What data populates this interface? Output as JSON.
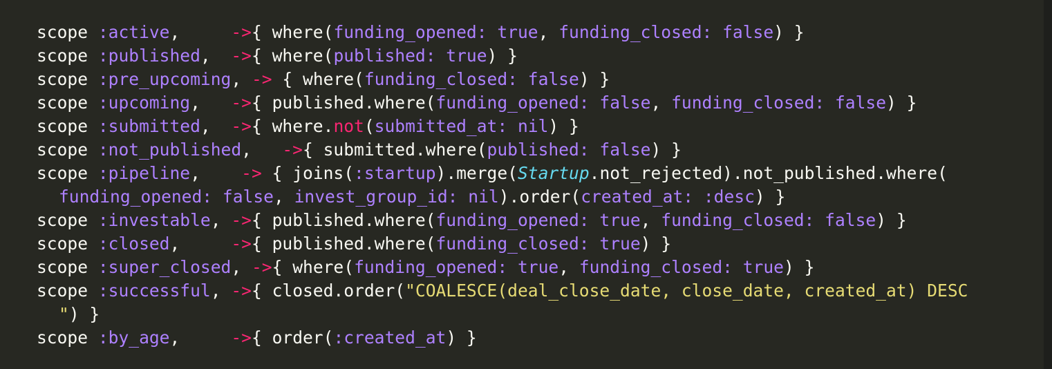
{
  "colors": {
    "background": "#272822",
    "plain": "#F8F8F2",
    "symbol": "#AE81FF",
    "operator": "#F92672",
    "constant": "#66D9EF",
    "string": "#E6DB74"
  },
  "code": {
    "lines": [
      [
        {
          "t": "kw",
          "s": "scope "
        },
        {
          "t": "sym",
          "s": ":active"
        },
        {
          "t": "pl",
          "s": ",     "
        },
        {
          "t": "arr",
          "s": "->"
        },
        {
          "t": "pl",
          "s": "{ where("
        },
        {
          "t": "sym",
          "s": "funding_opened: true"
        },
        {
          "t": "pl",
          "s": ", "
        },
        {
          "t": "sym",
          "s": "funding_closed: false"
        },
        {
          "t": "pl",
          "s": ") }"
        }
      ],
      [
        {
          "t": "kw",
          "s": "scope "
        },
        {
          "t": "sym",
          "s": ":published"
        },
        {
          "t": "pl",
          "s": ",  "
        },
        {
          "t": "arr",
          "s": "->"
        },
        {
          "t": "pl",
          "s": "{ where("
        },
        {
          "t": "sym",
          "s": "published: true"
        },
        {
          "t": "pl",
          "s": ") }"
        }
      ],
      [
        {
          "t": "kw",
          "s": "scope "
        },
        {
          "t": "sym",
          "s": ":pre_upcoming"
        },
        {
          "t": "pl",
          "s": ", "
        },
        {
          "t": "arr",
          "s": "->"
        },
        {
          "t": "pl",
          "s": " { where("
        },
        {
          "t": "sym",
          "s": "funding_closed: false"
        },
        {
          "t": "pl",
          "s": ") }"
        }
      ],
      [
        {
          "t": "kw",
          "s": "scope "
        },
        {
          "t": "sym",
          "s": ":upcoming"
        },
        {
          "t": "pl",
          "s": ",   "
        },
        {
          "t": "arr",
          "s": "->"
        },
        {
          "t": "pl",
          "s": "{ published.where("
        },
        {
          "t": "sym",
          "s": "funding_opened: false"
        },
        {
          "t": "pl",
          "s": ", "
        },
        {
          "t": "sym",
          "s": "funding_closed: false"
        },
        {
          "t": "pl",
          "s": ") }"
        }
      ],
      [
        {
          "t": "kw",
          "s": "scope "
        },
        {
          "t": "sym",
          "s": ":submitted"
        },
        {
          "t": "pl",
          "s": ",  "
        },
        {
          "t": "arr",
          "s": "->"
        },
        {
          "t": "pl",
          "s": "{ where."
        },
        {
          "t": "red",
          "s": "not"
        },
        {
          "t": "pl",
          "s": "("
        },
        {
          "t": "sym",
          "s": "submitted_at: nil"
        },
        {
          "t": "pl",
          "s": ") }"
        }
      ],
      [
        {
          "t": "kw",
          "s": "scope "
        },
        {
          "t": "sym",
          "s": ":not_published"
        },
        {
          "t": "pl",
          "s": ",   "
        },
        {
          "t": "arr",
          "s": "->"
        },
        {
          "t": "pl",
          "s": "{ submitted.where("
        },
        {
          "t": "sym",
          "s": "published: false"
        },
        {
          "t": "pl",
          "s": ") }"
        }
      ],
      [
        {
          "t": "kw",
          "s": "scope "
        },
        {
          "t": "sym",
          "s": ":pipeline"
        },
        {
          "t": "pl",
          "s": ",    "
        },
        {
          "t": "arr",
          "s": "->"
        },
        {
          "t": "pl",
          "s": " { joins("
        },
        {
          "t": "sym",
          "s": ":startup"
        },
        {
          "t": "pl",
          "s": ").merge("
        },
        {
          "t": "const",
          "s": "Startup"
        },
        {
          "t": "pl",
          "s": ".not_rejected).not_published.where("
        }
      ],
      [
        {
          "t": "sym",
          "s": "funding_opened: false"
        },
        {
          "t": "pl",
          "s": ", "
        },
        {
          "t": "sym",
          "s": "invest_group_id: nil"
        },
        {
          "t": "pl",
          "s": ").order("
        },
        {
          "t": "sym",
          "s": "created_at: :desc"
        },
        {
          "t": "pl",
          "s": ") }"
        }
      ],
      [
        {
          "t": "kw",
          "s": "scope "
        },
        {
          "t": "sym",
          "s": ":investable"
        },
        {
          "t": "pl",
          "s": ", "
        },
        {
          "t": "arr",
          "s": "->"
        },
        {
          "t": "pl",
          "s": "{ published.where("
        },
        {
          "t": "sym",
          "s": "funding_opened: true"
        },
        {
          "t": "pl",
          "s": ", "
        },
        {
          "t": "sym",
          "s": "funding_closed: false"
        },
        {
          "t": "pl",
          "s": ") }"
        }
      ],
      [
        {
          "t": "kw",
          "s": "scope "
        },
        {
          "t": "sym",
          "s": ":closed"
        },
        {
          "t": "pl",
          "s": ",     "
        },
        {
          "t": "arr",
          "s": "->"
        },
        {
          "t": "pl",
          "s": "{ published.where("
        },
        {
          "t": "sym",
          "s": "funding_closed: true"
        },
        {
          "t": "pl",
          "s": ") }"
        }
      ],
      [
        {
          "t": "kw",
          "s": "scope "
        },
        {
          "t": "sym",
          "s": ":super_closed"
        },
        {
          "t": "pl",
          "s": ", "
        },
        {
          "t": "arr",
          "s": "->"
        },
        {
          "t": "pl",
          "s": "{ where("
        },
        {
          "t": "sym",
          "s": "funding_opened: true"
        },
        {
          "t": "pl",
          "s": ", "
        },
        {
          "t": "sym",
          "s": "funding_closed: true"
        },
        {
          "t": "pl",
          "s": ") }"
        }
      ],
      [
        {
          "t": "kw",
          "s": "scope "
        },
        {
          "t": "sym",
          "s": ":successful"
        },
        {
          "t": "pl",
          "s": ", "
        },
        {
          "t": "arr",
          "s": "->"
        },
        {
          "t": "pl",
          "s": "{ closed.order("
        },
        {
          "t": "str",
          "s": "\"COALESCE(deal_close_date, close_date, created_at) DESC"
        }
      ],
      [
        {
          "t": "str",
          "s": "\""
        },
        {
          "t": "pl",
          "s": ") }"
        }
      ],
      [
        {
          "t": "kw",
          "s": "scope "
        },
        {
          "t": "sym",
          "s": ":by_age"
        },
        {
          "t": "pl",
          "s": ",     "
        },
        {
          "t": "arr",
          "s": "->"
        },
        {
          "t": "pl",
          "s": "{ order("
        },
        {
          "t": "sym",
          "s": ":created_at"
        },
        {
          "t": "pl",
          "s": ") }"
        }
      ]
    ]
  }
}
